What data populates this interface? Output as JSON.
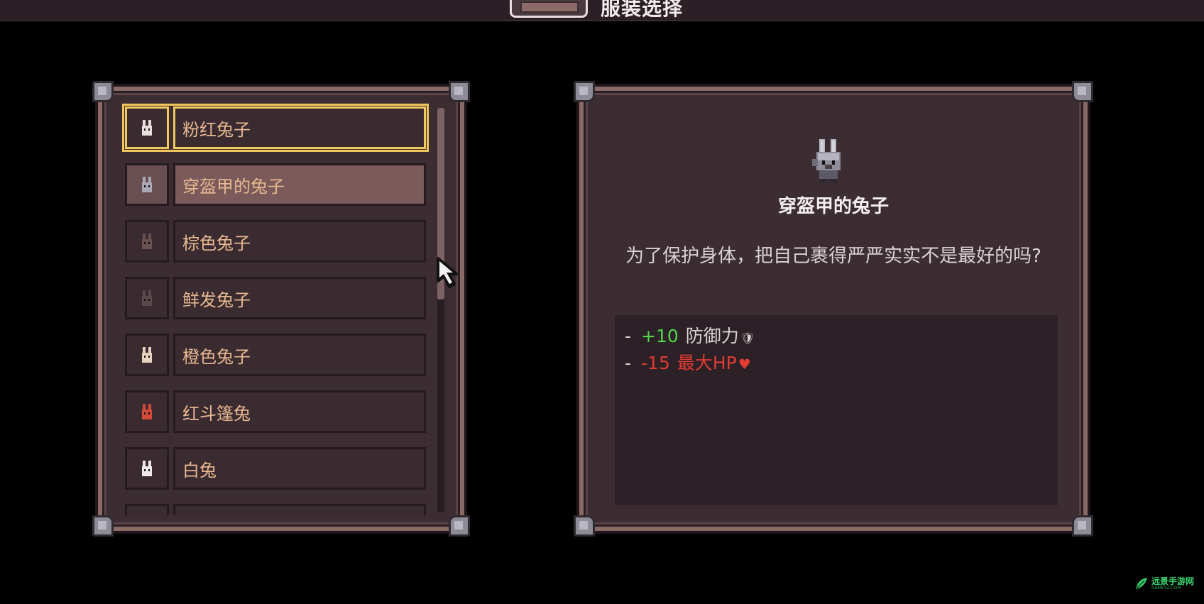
{
  "header": {
    "title": "服装选择",
    "icon": "wardrobe-icon"
  },
  "costume_list": {
    "selected_index": 0,
    "hover_index": 1,
    "items": [
      {
        "label": "粉红兔子",
        "icon": "pink-bunny-icon",
        "color": "#e9dede"
      },
      {
        "label": "穿盔甲的兔子",
        "icon": "armored-bunny-icon",
        "color": "#a9a8b4"
      },
      {
        "label": "棕色兔子",
        "icon": "brown-bunny-icon",
        "color": "#6b5050"
      },
      {
        "label": "鲜发兔子",
        "icon": "hairy-bunny-icon",
        "color": "#5a4a4c"
      },
      {
        "label": "橙色兔子",
        "icon": "orange-bunny-icon",
        "color": "#e7d2bf"
      },
      {
        "label": "红斗篷兔",
        "icon": "red-cloak-bunny-icon",
        "color": "#d44a3a"
      },
      {
        "label": "白兔",
        "icon": "white-bunny-icon",
        "color": "#efe8e8"
      },
      {
        "label": "",
        "icon": "",
        "color": "#3a2b31"
      }
    ],
    "scroll_fraction": 0.46
  },
  "detail": {
    "name": "穿盔甲的兔子",
    "description": "为了保护身体，把自己裹得严严实实不是最好的吗?",
    "sprite_icon": "armored-bunny-icon",
    "stats": [
      {
        "dash": "-",
        "value": "+10",
        "name": "防御力",
        "symbol": "🛡",
        "color": "#52d64a",
        "name_color": "#d9d2d4"
      },
      {
        "dash": "-",
        "value": "-15",
        "name": "最大HP",
        "symbol": "♥",
        "color": "#e23a33",
        "name_color": "#e23a33"
      }
    ]
  },
  "watermark": {
    "text": "远景手游网",
    "sub": "GAMEYZ.COM",
    "icon": "leaf-logo-icon"
  },
  "colors": {
    "selection": "#f3c45a",
    "label_text": "#e8b890"
  }
}
